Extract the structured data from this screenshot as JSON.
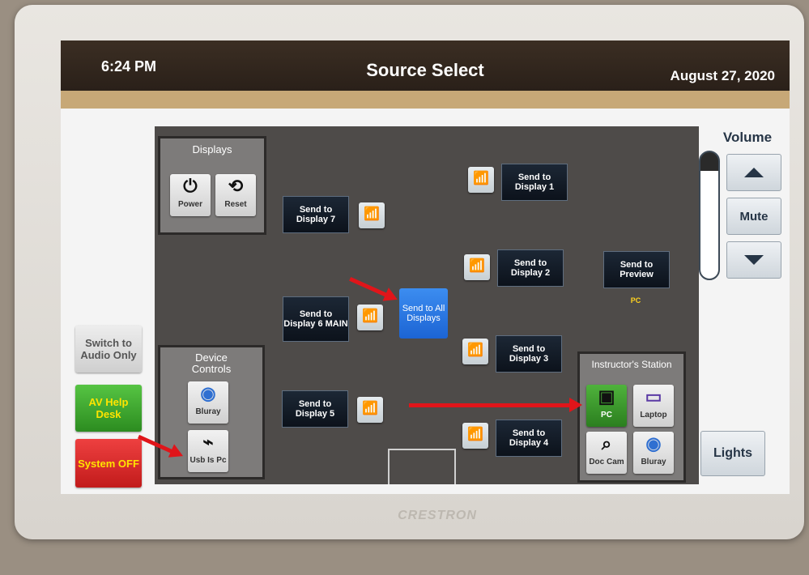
{
  "header": {
    "time": "6:24 PM",
    "title": "Source Select",
    "date": "August 27, 2020"
  },
  "brand": "CRESTRON",
  "displays": {
    "title": "Displays",
    "power_label": "Power",
    "reset_label": "Reset"
  },
  "device_controls": {
    "title": "Device Controls",
    "bluray_label": "Bluray",
    "usb_label": "Usb Is Pc"
  },
  "send_buttons": {
    "d1": "Send to Display 1",
    "d2": "Send to Display 2",
    "d3": "Send to Display 3",
    "d4": "Send to Display 4",
    "d5": "Send to Display 5",
    "d6": "Send to Display 6 MAIN",
    "d7": "Send to Display 7",
    "all": "Send to All Displays",
    "preview": "Send to Preview",
    "preview_source": "PC"
  },
  "instructor_station": {
    "title": "Instructor's Station",
    "pc_label": "PC",
    "laptop_label": "Laptop",
    "doc_cam_label": "Doc Cam",
    "bluray_label": "Bluray"
  },
  "side": {
    "switch_audio_label": "Switch to Audio Only",
    "help_desk_label": "AV Help Desk",
    "system_off_label": "System OFF"
  },
  "volume": {
    "title": "Volume",
    "mute_label": "Mute",
    "level_fraction": 0.85
  },
  "lights_label": "Lights",
  "colors": {
    "header_bg": "#2e231b",
    "accent_bar": "#c7a877",
    "send_all": "#2a74e6",
    "help_desk": "#3aa02c",
    "system_off": "#d92b2b",
    "pc_selected": "#3c9a2a",
    "annotation_arrow": "#e0151a"
  }
}
